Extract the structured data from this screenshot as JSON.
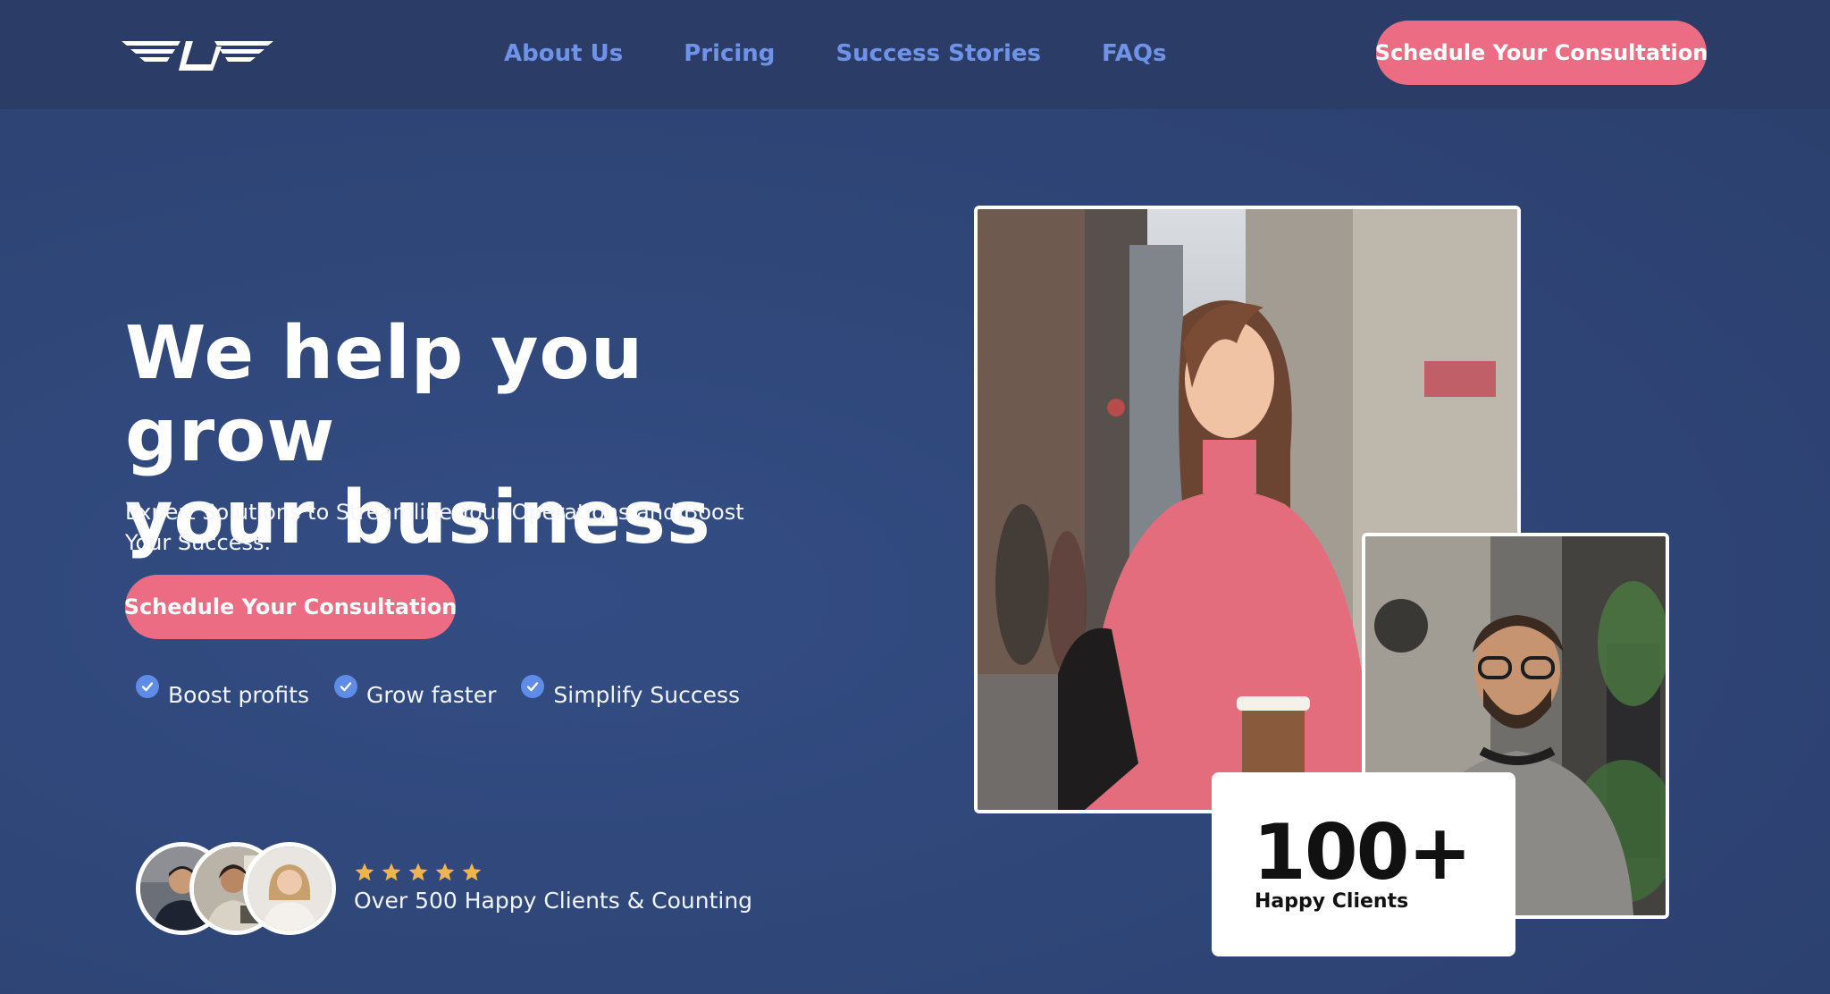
{
  "nav": {
    "links": [
      "About Us",
      "Pricing",
      "Success Stories",
      "FAQs"
    ],
    "cta_label": "Schedule Your Consultation"
  },
  "hero": {
    "title_line1": "We help you grow",
    "title_line2": "your business",
    "subtitle": "Expert Solutions to Streamline Your Operations and Boost Your Success.",
    "cta_label": "Schedule Your Consultation",
    "benefits": [
      "Boost profits",
      "Grow faster",
      "Simplify Success"
    ]
  },
  "social_proof": {
    "rating_stars": 5,
    "text": "Over 500 Happy Clients & Counting"
  },
  "stat_card": {
    "number": "100+",
    "label": "Happy Clients"
  },
  "colors": {
    "background": "#2f4678",
    "nav_background": "#2b3d66",
    "accent": "#ec6c84",
    "link": "#6f93e8",
    "check": "#5f8ce6",
    "star": "#f1b44c"
  },
  "icons": {
    "logo": "winged-logo-icon",
    "check": "check-circle-icon",
    "star": "star-icon"
  }
}
